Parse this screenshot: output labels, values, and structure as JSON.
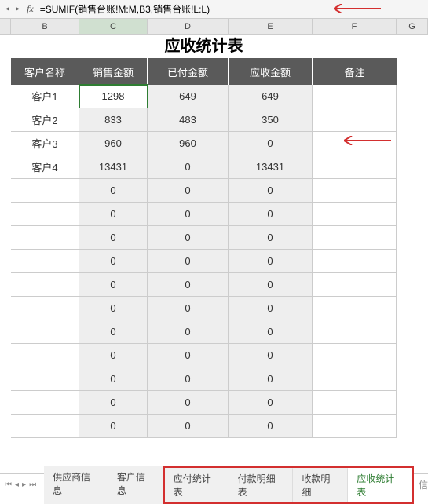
{
  "formula_bar": {
    "fx_label": "fx",
    "formula": "=SUMIF(销售台账!M:M,B3,销售台账!L:L)"
  },
  "columns": [
    "B",
    "C",
    "D",
    "E",
    "F",
    "G"
  ],
  "title": "应收统计表",
  "headers": [
    "客户名称",
    "销售金额",
    "已付金额",
    "应收金额",
    "备注"
  ],
  "selected_cell": {
    "row": 0,
    "col": 1
  },
  "rows": [
    {
      "name": "客户1",
      "sale": "1298",
      "paid": "649",
      "due": "649",
      "remark": ""
    },
    {
      "name": "客户2",
      "sale": "833",
      "paid": "483",
      "due": "350",
      "remark": ""
    },
    {
      "name": "客户3",
      "sale": "960",
      "paid": "960",
      "due": "0",
      "remark": ""
    },
    {
      "name": "客户4",
      "sale": "13431",
      "paid": "0",
      "due": "13431",
      "remark": ""
    },
    {
      "name": "",
      "sale": "0",
      "paid": "0",
      "due": "0",
      "remark": ""
    },
    {
      "name": "",
      "sale": "0",
      "paid": "0",
      "due": "0",
      "remark": ""
    },
    {
      "name": "",
      "sale": "0",
      "paid": "0",
      "due": "0",
      "remark": ""
    },
    {
      "name": "",
      "sale": "0",
      "paid": "0",
      "due": "0",
      "remark": ""
    },
    {
      "name": "",
      "sale": "0",
      "paid": "0",
      "due": "0",
      "remark": ""
    },
    {
      "name": "",
      "sale": "0",
      "paid": "0",
      "due": "0",
      "remark": ""
    },
    {
      "name": "",
      "sale": "0",
      "paid": "0",
      "due": "0",
      "remark": ""
    },
    {
      "name": "",
      "sale": "0",
      "paid": "0",
      "due": "0",
      "remark": ""
    },
    {
      "name": "",
      "sale": "0",
      "paid": "0",
      "due": "0",
      "remark": ""
    },
    {
      "name": "",
      "sale": "0",
      "paid": "0",
      "due": "0",
      "remark": ""
    },
    {
      "name": "",
      "sale": "0",
      "paid": "0",
      "due": "0",
      "remark": ""
    }
  ],
  "tabs": {
    "items": [
      "供应商信息",
      "客户信息",
      "应付统计表",
      "付款明细表",
      "收款明细",
      "应收统计表"
    ],
    "active_index": 5,
    "highlight_start": 2,
    "extra_label": "信"
  },
  "chart_data": {
    "type": "table",
    "title": "应收统计表",
    "columns": [
      "客户名称",
      "销售金额",
      "已付金额",
      "应收金额",
      "备注"
    ],
    "data": [
      [
        "客户1",
        1298,
        649,
        649,
        ""
      ],
      [
        "客户2",
        833,
        483,
        350,
        ""
      ],
      [
        "客户3",
        960,
        960,
        0,
        ""
      ],
      [
        "客户4",
        13431,
        0,
        13431,
        ""
      ]
    ]
  }
}
